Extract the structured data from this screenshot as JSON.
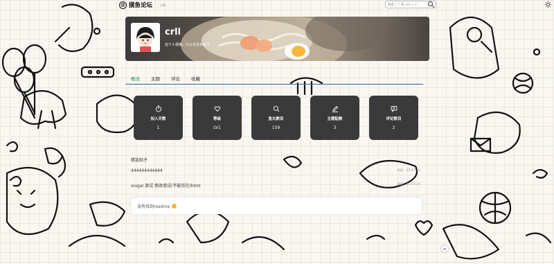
{
  "header": {
    "logo_mark": "@",
    "site_name": "摸鱼论坛",
    "site_sub": "日常",
    "search_placeholder": "搜索 ( '/' 或 ctrl + / )"
  },
  "profile": {
    "username": "crll",
    "bio": "这个人很懒，什么也没有留下"
  },
  "tabs": [
    {
      "label": "概况",
      "active": true
    },
    {
      "label": "主题",
      "active": false
    },
    {
      "label": "评论",
      "active": false
    },
    {
      "label": "收藏",
      "active": false
    }
  ],
  "stats": [
    {
      "label": "加入天数",
      "value": "1",
      "icon": "timer-icon"
    },
    {
      "label": "等级",
      "value": "LV1",
      "icon": "heart-icon"
    },
    {
      "label": "鱼丸数目",
      "value": "159",
      "icon": "search-icon"
    },
    {
      "label": "主题贴数",
      "value": "3",
      "icon": "pencil-icon"
    },
    {
      "label": "评论数目",
      "value": "2",
      "icon": "comment-icon"
    }
  ],
  "featured": {
    "title": "精选帖子",
    "posts": [
      {
        "title": "444444444444",
        "date": "日前 · 25-07-23"
      },
      {
        "title": "xiugai 测试 修改测试(不能存在)html",
        "date": "日前 · 25-07-23"
      }
    ]
  },
  "readme": {
    "text": "没有找到readme"
  },
  "colors": {
    "accent": "#1a8f5a",
    "tab_line": "#2b5fa8",
    "card": "#3a3a3a"
  }
}
